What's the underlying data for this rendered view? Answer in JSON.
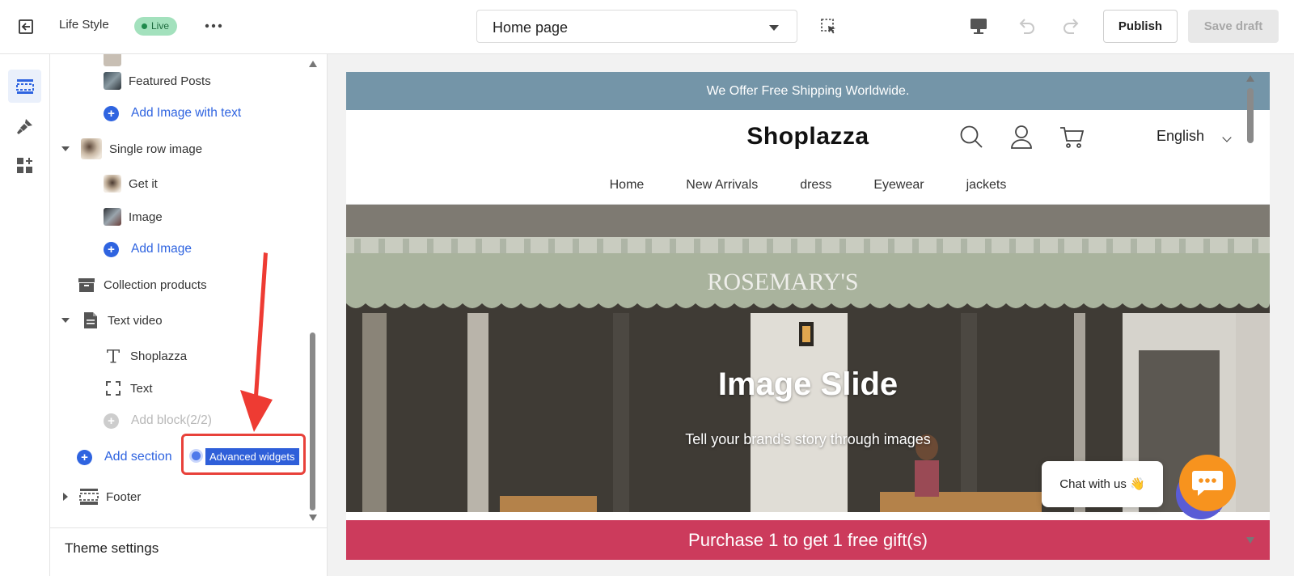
{
  "topbar": {
    "store_name": "Life Style",
    "status_badge": "Live",
    "page_selector": "Home page",
    "publish_label": "Publish",
    "save_draft_label": "Save draft"
  },
  "rail": {
    "items": [
      "sections-icon",
      "theme-brush-icon",
      "apps-icon"
    ]
  },
  "sidebar": {
    "items": [
      {
        "label": "Featured Posts"
      },
      {
        "label": "Add Image with text"
      },
      {
        "label": "Single row image"
      },
      {
        "label": "Get it"
      },
      {
        "label": "Image"
      },
      {
        "label": "Add Image"
      },
      {
        "label": "Collection products"
      },
      {
        "label": "Text video"
      },
      {
        "label": "Shoplazza"
      },
      {
        "label": "Text"
      },
      {
        "label": "Add block(2/2)"
      },
      {
        "label": "Add section"
      },
      {
        "label": "Footer"
      }
    ],
    "advanced_widgets": "Advanced widgets",
    "theme_settings": "Theme settings"
  },
  "preview": {
    "announcement": "We Offer Free Shipping Worldwide.",
    "logo": "Shoplazza",
    "language": "English",
    "nav": [
      "Home",
      "New Arrivals",
      "dress",
      "Eyewear",
      "jackets"
    ],
    "hero_sign": "ROSEMARY'S",
    "hero_title": "Image Slide",
    "hero_subtitle": "Tell your brand's story through images",
    "promo": "Purchase 1 to get 1 free gift(s)",
    "chat_label": "Chat with us 👋"
  },
  "colors": {
    "accent": "#2f64e0",
    "live_badge": "#a3e1bd",
    "announcement_bar": "#7495a8",
    "promo_bar": "#cc3b5c",
    "chat_button": "#f7931e",
    "highlight_box": "#e8413a"
  }
}
